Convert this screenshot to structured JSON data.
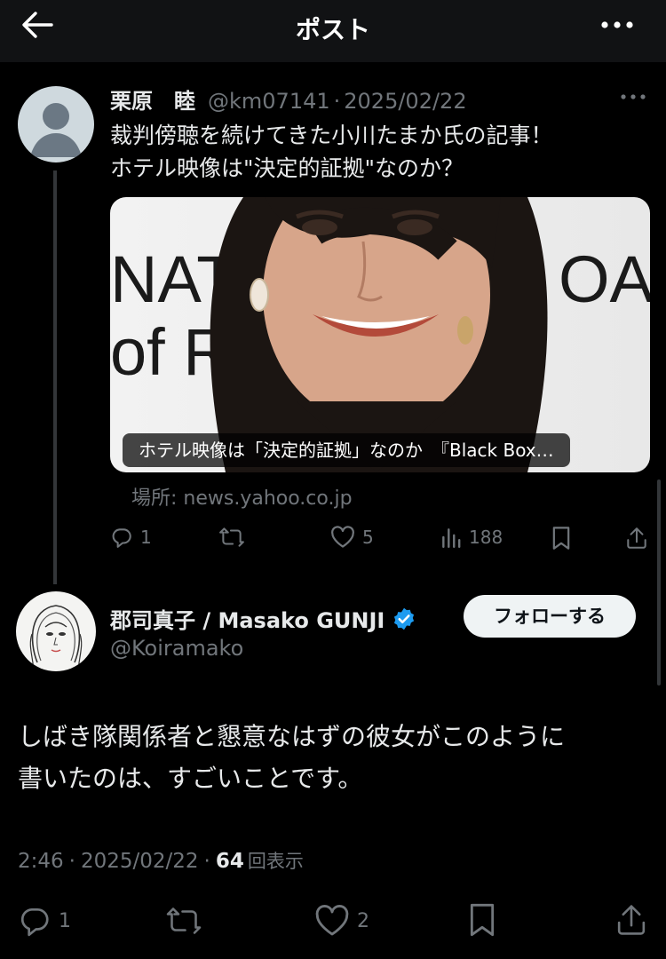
{
  "header": {
    "title": "ポスト"
  },
  "parent": {
    "name": "栗原　睦",
    "handle": "@km07141",
    "sep": "·",
    "date": "2025/02/22",
    "text_line1": "裁判傍聴を続けてきた小川たまか氏の記事！",
    "text_line2": "ホテル映像は\"決定的証拠\"なのか？",
    "card_caption": "ホテル映像は「決定的証拠」なのか　『Black Box…",
    "card_source": "場所: news.yahoo.co.jp",
    "actions": {
      "replies": "1",
      "reposts": "",
      "likes": "5",
      "views": "188"
    }
  },
  "main": {
    "name": "郡司真子 / Masako GUNJI",
    "handle": "@Koiramako",
    "follow_label": "フォローする",
    "text_line1": "しばき隊関係者と懇意なはずの彼女がこのように",
    "text_line2": "書いたのは、すごいことです。",
    "time": "2:46",
    "sep": "·",
    "date": "2025/02/22",
    "views_count": "64",
    "views_label": "回表示",
    "actions": {
      "replies": "1",
      "reposts": "",
      "likes": "2"
    }
  },
  "colors": {
    "background": "#000000",
    "verified": "#1d9bf0",
    "muted": "#71767b",
    "text": "#e7e9ea"
  },
  "icons": [
    "back-arrow-icon",
    "more-icon",
    "reply-icon",
    "repost-icon",
    "like-icon",
    "views-icon",
    "bookmark-icon",
    "share-icon",
    "verified-badge-icon"
  ]
}
